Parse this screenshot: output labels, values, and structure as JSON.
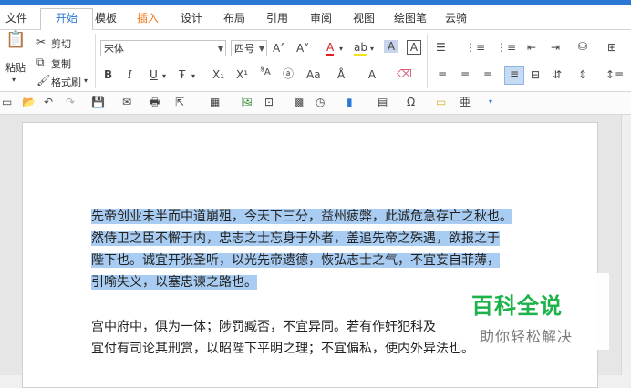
{
  "tabs": [
    "文件",
    "开始",
    "模板",
    "插入",
    "设计",
    "布局",
    "引用",
    "审阅",
    "视图",
    "绘图笔",
    "云骑"
  ],
  "clipboard": {
    "paste_label": "粘贴",
    "cut_label": "剪切",
    "copy_label": "复制",
    "format_painter_label": "格式刷"
  },
  "font": {
    "family": "宋体",
    "size": "四号"
  },
  "document": {
    "paragraph1_lines": [
      "先帝创业未半而中道崩殂，今天下三分，益州疲弊，此诚危急存亡之秋也。",
      "然侍卫之臣不懈于内，忠志之士忘身于外者，盖追先帝之殊遇，欲报之于",
      "陛下也。诚宜开张圣听，以光先帝遗德，恢弘志士之气，不宜妄自菲薄，",
      "引喻失义，以塞忠谏之路也。"
    ],
    "paragraph2_lines": [
      "宫中府中，俱为一体；陟罚臧否，不宜异同。若有作奸犯科及",
      "宜付有司论其刑赏，以昭陛下平明之理；不宜偏私，使内外异法也。"
    ]
  },
  "watermark": {
    "logo": "百科全说",
    "slogan": "助你轻松解决"
  },
  "colors": {
    "accent": "#2b79d4",
    "selection": "#a9cdf2",
    "watermark_green": "#1db34a"
  }
}
